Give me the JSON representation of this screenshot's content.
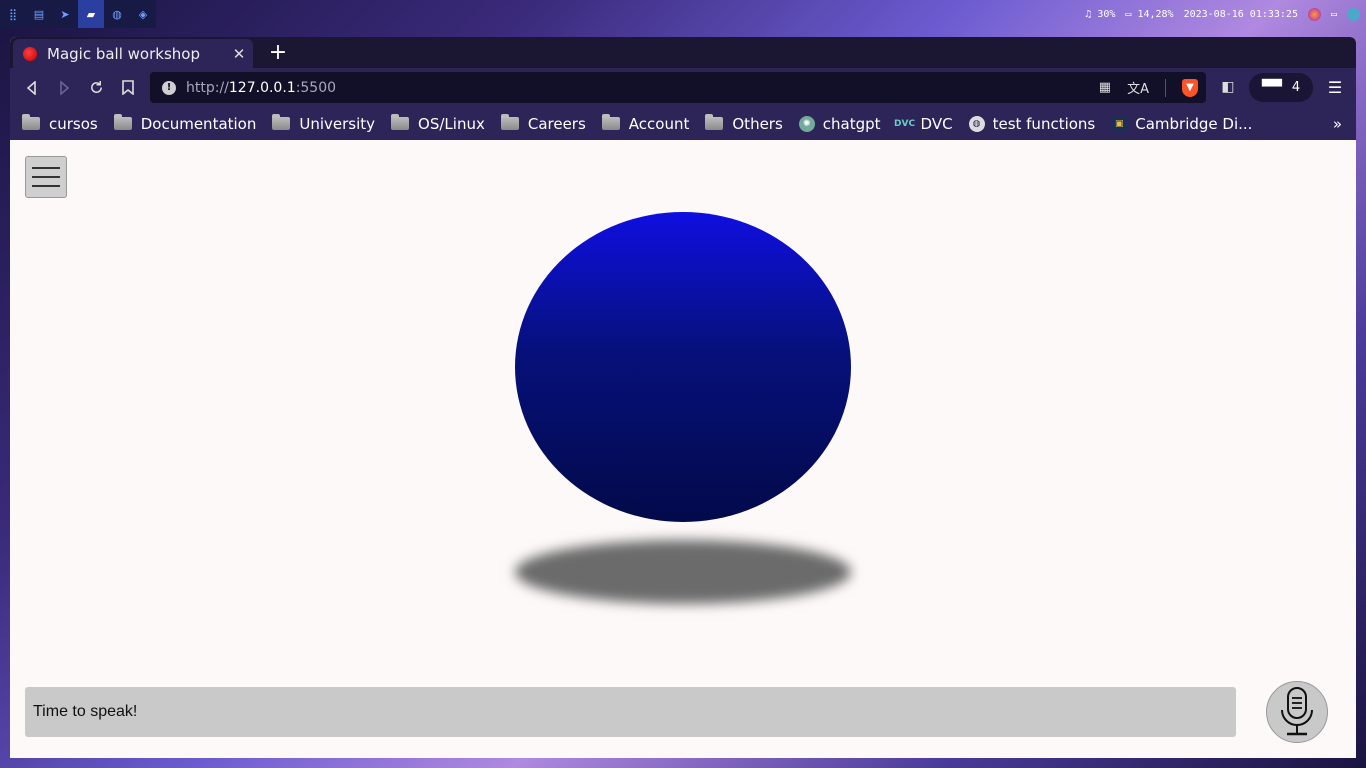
{
  "os": {
    "workspaces": [
      "⣿",
      "▤",
      "➤",
      "▰",
      "◍",
      "◈"
    ],
    "volume": "30%",
    "battery": "14,28%",
    "datetime": "2023-08-16 01:33:25"
  },
  "browser": {
    "tab_title": "Magic ball workshop",
    "tab_close": "✕",
    "new_tab": "+",
    "url_scheme": "http://",
    "url_host": "127.0.0.1",
    "url_port": ":5500",
    "extension_count": "4",
    "bookmarks": [
      {
        "label": "cursos",
        "icon": "folder-icon"
      },
      {
        "label": "Documentation",
        "icon": "folder-icon"
      },
      {
        "label": "University",
        "icon": "folder-icon"
      },
      {
        "label": "OS/Linux",
        "icon": "folder-icon"
      },
      {
        "label": "Careers",
        "icon": "folder-icon"
      },
      {
        "label": "Account",
        "icon": "folder-icon"
      },
      {
        "label": "Others",
        "icon": "folder-icon"
      },
      {
        "label": "chatgpt",
        "icon": "chatgpt-icon"
      },
      {
        "label": "DVC",
        "icon": "dvc-icon"
      },
      {
        "label": "test functions",
        "icon": "globe-icon"
      },
      {
        "label": "Cambridge Di...",
        "icon": "cambridge-icon"
      }
    ],
    "bookmarks_more": "»"
  },
  "page": {
    "speech_text": "Time to speak!",
    "ball_color_top": "#0f0fe0",
    "ball_color_bottom": "#030a4a"
  }
}
